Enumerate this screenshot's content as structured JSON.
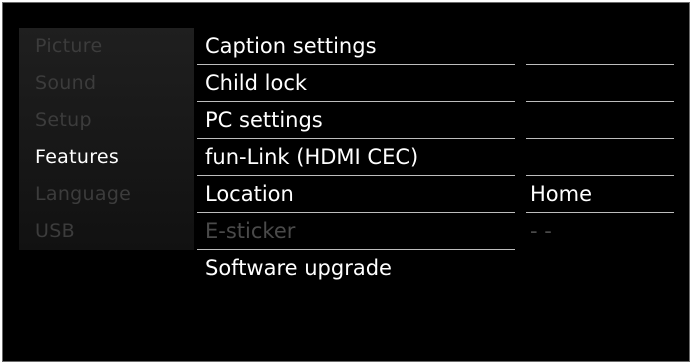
{
  "categories": [
    {
      "label": "Picture",
      "active": false
    },
    {
      "label": "Sound",
      "active": false
    },
    {
      "label": "Setup",
      "active": false
    },
    {
      "label": "Features",
      "active": true
    },
    {
      "label": "Language",
      "active": false
    },
    {
      "label": "USB",
      "active": false
    }
  ],
  "options": [
    {
      "label": "Caption settings",
      "value": "",
      "disabled": false
    },
    {
      "label": "Child lock",
      "value": "",
      "disabled": false
    },
    {
      "label": "PC settings",
      "value": "",
      "disabled": false
    },
    {
      "label": "fun-Link (HDMI CEC)",
      "value": "",
      "disabled": false
    },
    {
      "label": "Location",
      "value": "Home",
      "disabled": false
    },
    {
      "label": "E-sticker",
      "value": "- -",
      "disabled": true
    },
    {
      "label": "Software upgrade",
      "value": "",
      "disabled": false
    }
  ],
  "colors": {
    "background": "#000000",
    "active_text": "#ffffff",
    "inactive_category_text": "#3c3c3c",
    "disabled_text": "#4a4a4a",
    "divider": "#bdbdbd"
  }
}
